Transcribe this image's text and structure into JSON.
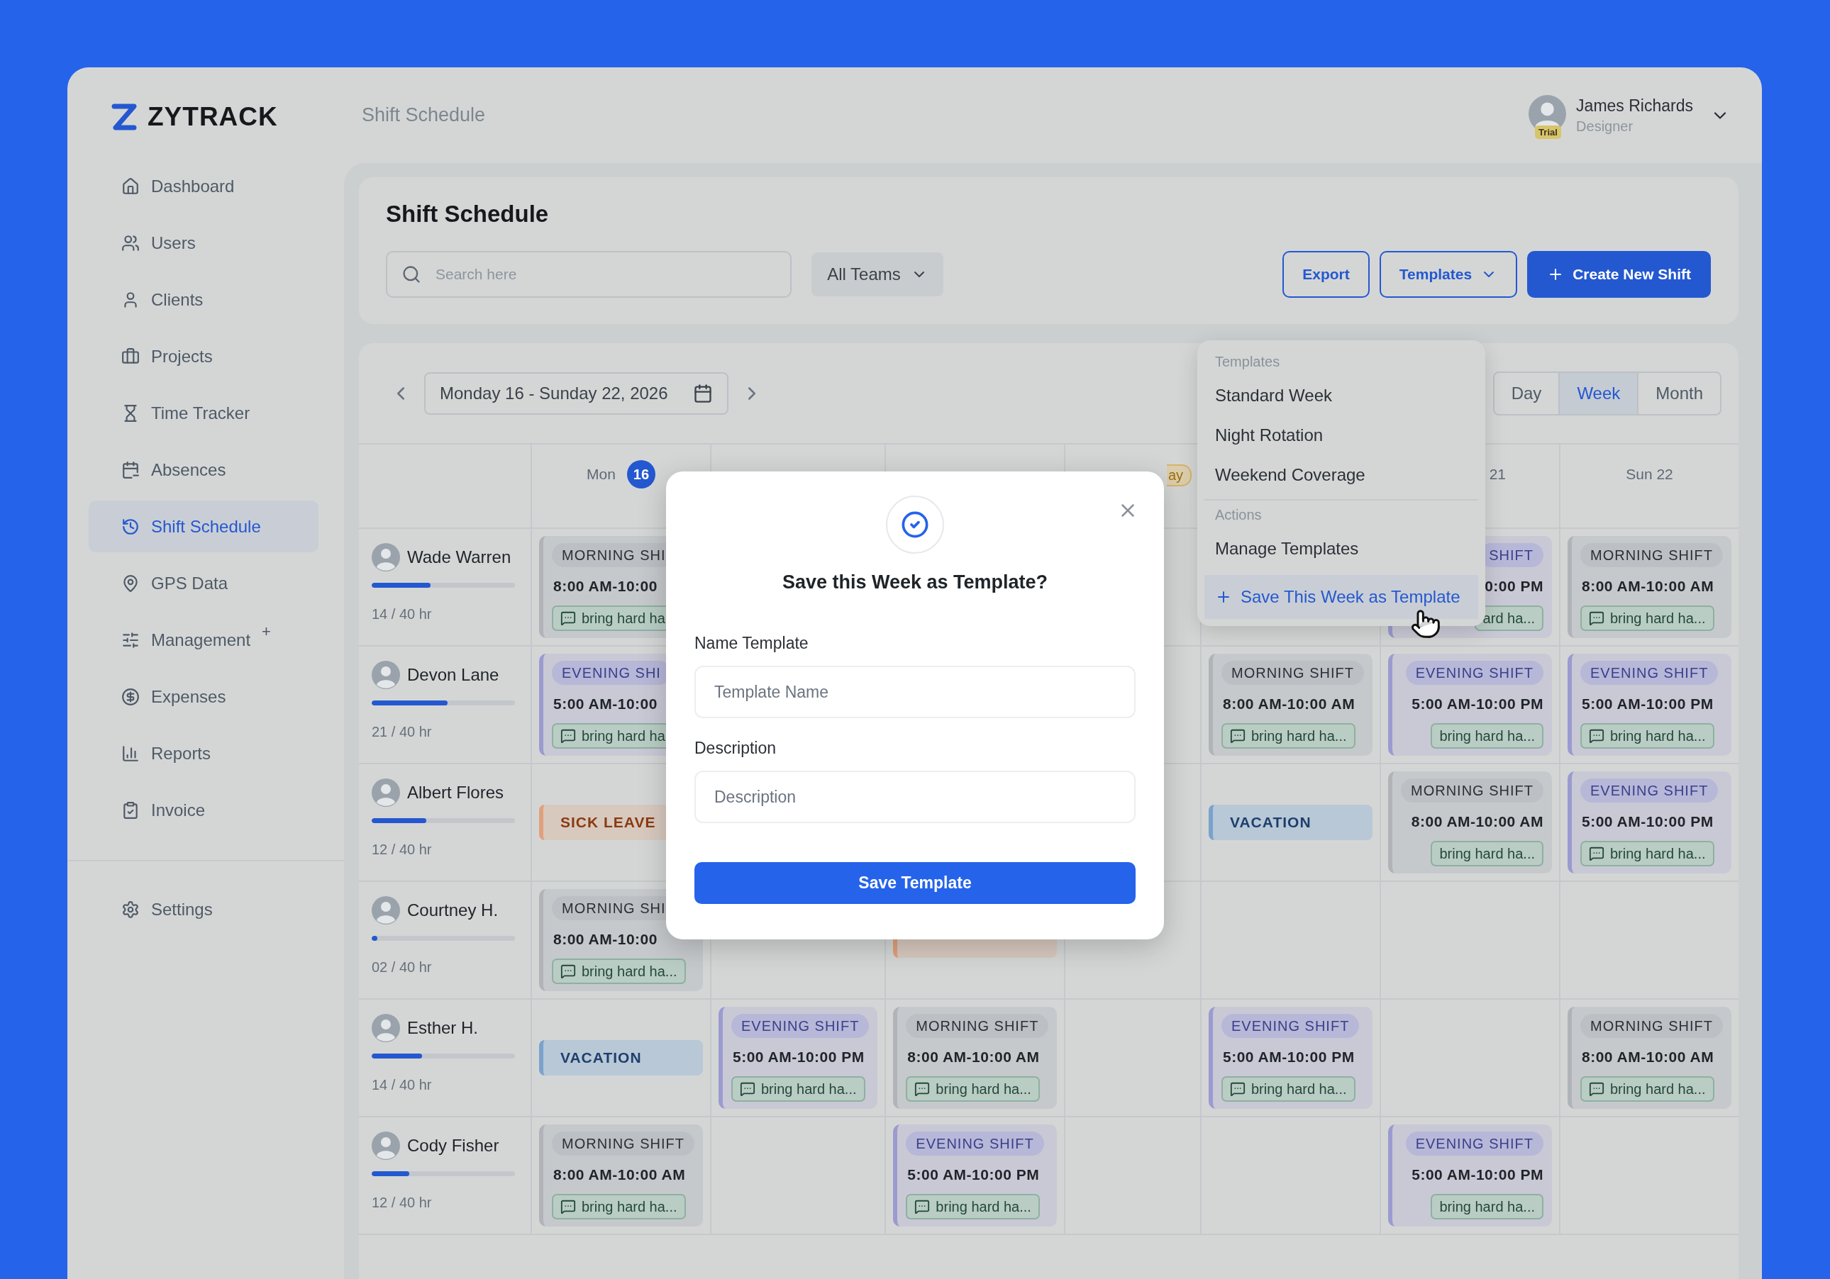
{
  "brand": {
    "name": "ZYTRACK"
  },
  "nav": [
    {
      "label": "Dashboard",
      "selected": false
    },
    {
      "label": "Users",
      "selected": false
    },
    {
      "label": "Clients",
      "selected": false
    },
    {
      "label": "Projects",
      "selected": false
    },
    {
      "label": "Time Tracker",
      "selected": false
    },
    {
      "label": "Absences",
      "selected": false
    },
    {
      "label": "Shift Schedule",
      "selected": true
    },
    {
      "label": "GPS Data",
      "selected": false
    },
    {
      "label": "Management",
      "selected": false,
      "badge": "+"
    },
    {
      "label": "Expenses",
      "selected": false
    },
    {
      "label": "Reports",
      "selected": false
    },
    {
      "label": "Invoice",
      "selected": false
    }
  ],
  "settings": {
    "label": "Settings",
    "selected": false
  },
  "header": {
    "title": "Shift Schedule"
  },
  "user": {
    "name": "James Richards",
    "role": "Designer",
    "badge": "Trial"
  },
  "page": {
    "title": "Shift Schedule",
    "search": {
      "placeholder": "Search here"
    },
    "team_filter": "All Teams",
    "buttons": [
      {
        "label": "Export",
        "kind": "outline"
      },
      {
        "label": "Templates",
        "kind": "menu"
      },
      {
        "label": "Create New Shift",
        "kind": "primary"
      }
    ]
  },
  "calendar": {
    "range": "Monday 16 - Sunday 22, 2026",
    "views": [
      {
        "label": "Day",
        "selected": false
      },
      {
        "label": "Week",
        "selected": true
      },
      {
        "label": "Month",
        "selected": false
      }
    ],
    "days": [
      {
        "label": "Mon",
        "badge": "16"
      },
      {
        "tag": "ay"
      },
      {
        "label": "21"
      },
      {
        "label": "Sun 22"
      }
    ],
    "rows": [
      {
        "name": "Wade Warren",
        "level": 0.41,
        "hours": "14 / 40 hr",
        "cells": [
          {
            "kind": "morning",
            "title": "MORNING SHI",
            "time": "8:00 AM-10:00",
            "note": "bring hard ha"
          },
          {},
          {},
          {},
          {},
          {
            "kind": "evening",
            "title": "SHIFT",
            "time": "0:00 PM",
            "note": "ard ha..."
          },
          {
            "kind": "morning",
            "title": "MORNING SHIFT",
            "time": "8:00 AM-10:00 AM",
            "note": "bring hard ha..."
          }
        ]
      },
      {
        "name": "Devon Lane",
        "level": 0.53,
        "hours": "21 / 40 hr",
        "cells": [
          {
            "kind": "evening",
            "title": "EVENING SHI",
            "time": "5:00 AM-10:00",
            "note": "bring hard ha"
          },
          {},
          {},
          {},
          {
            "kind": "morning",
            "title": "MORNING SHIFT",
            "time": "8:00 AM-10:00 AM",
            "note": "bring hard ha..."
          },
          {
            "kind": "evening",
            "title": "EVENING SHIFT",
            "time": "5:00 AM-10:00 PM",
            "note": "bring hard ha..."
          },
          {
            "kind": "evening",
            "title": "EVENING SHIFT",
            "time": "5:00 AM-10:00 PM",
            "note": "bring hard ha..."
          }
        ]
      },
      {
        "name": "Albert Flores",
        "level": 0.38,
        "hours": "12 / 40 hr",
        "cells": [
          {
            "kind": "sick",
            "title": "SICK LEAVE"
          },
          {},
          {},
          {},
          {
            "kind": "vacation",
            "title": "VACATION"
          },
          {
            "kind": "morning",
            "title": "MORNING SHIFT",
            "time": "8:00 AM-10:00 AM",
            "note": "bring hard ha..."
          },
          {
            "kind": "evening",
            "title": "EVENING SHIFT",
            "time": "5:00 AM-10:00 PM",
            "note": "bring hard ha..."
          }
        ]
      },
      {
        "name": "Courtney H.",
        "level": 0.04,
        "hours": "02 / 40 hr",
        "cells": [
          {
            "kind": "morning",
            "title": "MORNING SHI",
            "time": "8:00 AM-10:00",
            "note": "bring hard ha..."
          },
          {},
          {
            "kind": "sick"
          },
          {},
          {},
          {},
          {}
        ]
      },
      {
        "name": "Esther H.",
        "level": 0.35,
        "hours": "14 / 40 hr",
        "cells": [
          {
            "kind": "vacation",
            "title": "VACATION"
          },
          {
            "kind": "evening",
            "title": "EVENING SHIFT",
            "time": "5:00 AM-10:00 PM",
            "note": "bring hard ha..."
          },
          {
            "kind": "morning",
            "title": "MORNING SHIFT",
            "time": "8:00 AM-10:00 AM",
            "note": "bring hard ha..."
          },
          {},
          {
            "kind": "evening",
            "title": "EVENING SHIFT",
            "time": "5:00 AM-10:00 PM",
            "note": "bring hard ha..."
          },
          {},
          {
            "kind": "morning",
            "title": "MORNING SHIFT",
            "time": "8:00 AM-10:00 AM",
            "note": "bring hard ha..."
          }
        ]
      },
      {
        "name": "Cody Fisher",
        "level": 0.26,
        "hours": "12 / 40 hr",
        "cells": [
          {
            "kind": "morning",
            "title": "MORNING SHIFT",
            "time": "8:00 AM-10:00 AM",
            "note": "bring hard ha..."
          },
          {},
          {
            "kind": "evening",
            "title": "EVENING SHIFT",
            "time": "5:00 AM-10:00 PM",
            "note": "bring hard ha..."
          },
          {},
          {},
          {
            "kind": "evening",
            "title": "EVENING SHIFT",
            "time": "5:00 AM-10:00 PM",
            "note": "bring hard ha..."
          },
          {}
        ]
      }
    ]
  },
  "dropdown": {
    "sections": [
      {
        "title": "Templates",
        "items": [
          {
            "label": "Standard Week",
            "selected": false
          },
          {
            "label": "Night Rotation",
            "selected": false
          },
          {
            "label": "Weekend Coverage",
            "selected": false
          }
        ]
      },
      {
        "title": "Actions",
        "items": [
          {
            "label": "Manage Templates",
            "selected": false
          },
          {
            "label": "Save This Week as Template",
            "selected": true,
            "kind": "add"
          }
        ]
      }
    ]
  },
  "modal": {
    "title": "Save this Week as Template?",
    "fields": [
      {
        "label": "Name Template",
        "placeholder": "Template Name"
      },
      {
        "label": "Description",
        "placeholder": "Description"
      }
    ],
    "button": "Save Template"
  }
}
